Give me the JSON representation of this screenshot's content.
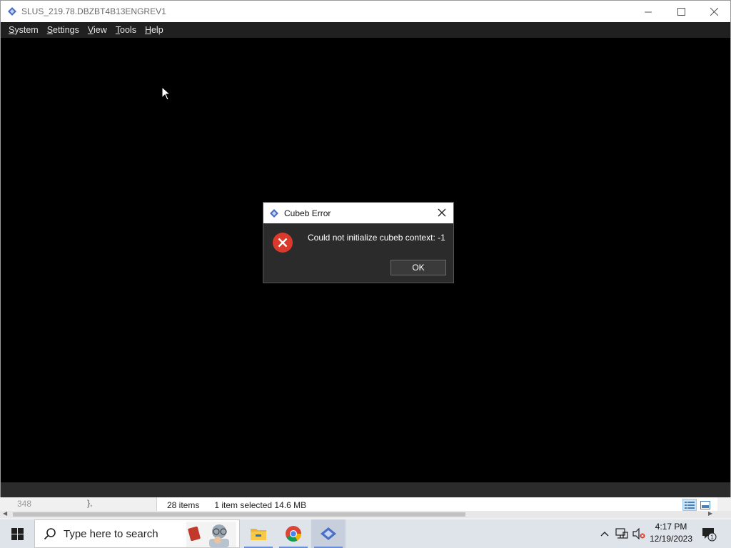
{
  "window": {
    "title": "SLUS_219.78.DBZBT4B13ENGREV1",
    "controls": {
      "minimize": "—",
      "maximize": "☐",
      "close": "✕"
    }
  },
  "menu": {
    "items": [
      {
        "first": "S",
        "rest": "ystem"
      },
      {
        "first": "S",
        "rest": "ettings"
      },
      {
        "first": "V",
        "rest": "iew"
      },
      {
        "first": "T",
        "rest": "ools"
      },
      {
        "first": "H",
        "rest": "elp"
      }
    ]
  },
  "dialog": {
    "title": "Cubeb Error",
    "close": "✕",
    "message": "Could not initialize cubeb context: -1",
    "ok_label": "OK"
  },
  "explorer": {
    "line_number": "348",
    "line_code": "},",
    "item_count": "28 items",
    "selection": "1 item selected  14.6 MB"
  },
  "taskbar": {
    "search_placeholder": "Type here to search",
    "clock_time": "4:17 PM",
    "clock_date": "12/19/2023",
    "notification_count": "1"
  },
  "colors": {
    "dialog_bg": "#2b2b2b",
    "error_red": "#d93a2b",
    "accent": "#4a6fc4"
  }
}
